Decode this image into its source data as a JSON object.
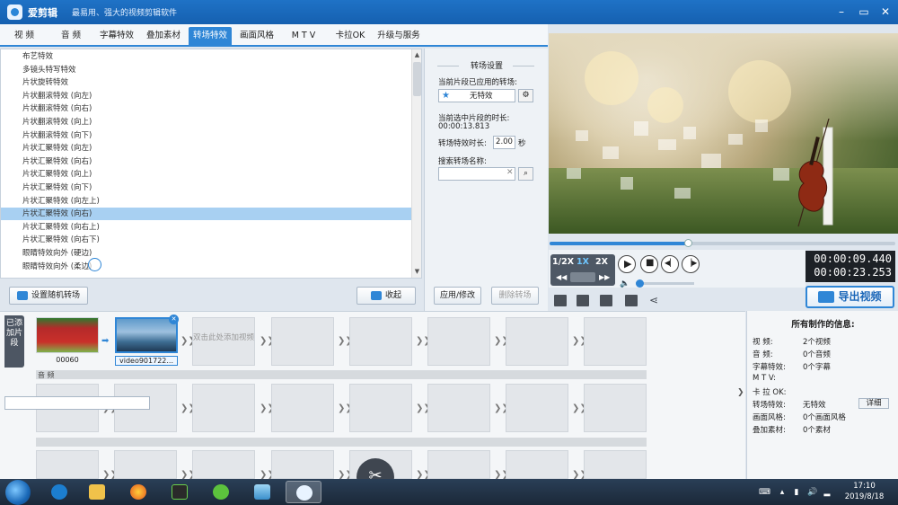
{
  "window": {
    "app_name": "爱剪辑",
    "slogan": "最易用、强大的视频剪辑软件",
    "controls": [
      "–",
      "▭",
      "✕"
    ]
  },
  "tabs": [
    "视 频",
    "音 频",
    "字幕特效",
    "叠加素材",
    "转场特效",
    "画面风格",
    "M T V",
    "卡拉OK",
    "升级与服务"
  ],
  "active_tab": "转场特效",
  "effects": {
    "items": [
      "布艺特效",
      "多镜头特写特效",
      "片状旋转特效",
      "片状翻滚特效 (向左)",
      "片状翻滚特效 (向右)",
      "片状翻滚特效 (向上)",
      "片状翻滚特效 (向下)",
      "片状汇聚特效 (向左)",
      "片状汇聚特效 (向右)",
      "片状汇聚特效 (向上)",
      "片状汇聚特效 (向下)",
      "片状汇聚特效 (向左上)",
      "片状汇聚特效 (向右)",
      "片状汇聚特效 (向右上)",
      "片状汇聚特效 (向右下)",
      "眼睛特效向外 (硬边)",
      "眼睛特效向外 (柔边)"
    ],
    "selected_index": 12,
    "random_button": "设置随机转场",
    "collapse_button": "收起"
  },
  "settings": {
    "title": "转场设置",
    "applied_label": "当前片段已应用的转场:",
    "applied_value": "无特效",
    "duration_label": "当前选中片段的时长:",
    "duration_value": "00:00:13.813",
    "effect_duration_label": "转场特效时长:",
    "effect_duration_value": "2.00",
    "effect_duration_unit": "秒",
    "search_label": "搜索转场名称:",
    "search_value": "",
    "apply_button": "应用/修改",
    "delete_button": "删除转场"
  },
  "player": {
    "speeds": [
      "1/2X",
      "1X",
      "2X"
    ],
    "active_speed": "1X",
    "progress": 0.4,
    "current_time": "00:00:09.440",
    "total_time": "00:00:23.253",
    "export_button": "导出视频"
  },
  "timeline": {
    "side_label": "已添加片段",
    "clips": [
      {
        "label": "00060"
      },
      {
        "label": "video901722..."
      }
    ],
    "empty_slot_text": "双击此处添加视频",
    "audio_label": "音 频"
  },
  "info": {
    "title": "所有制作的信息:",
    "rows": [
      {
        "key": "视    频:",
        "value": "2个视频"
      },
      {
        "key": "音    频:",
        "value": "0个音频"
      },
      {
        "key": "字幕特效:",
        "value": "0个字幕"
      },
      {
        "key": "M  T  V:",
        "value": ""
      },
      {
        "key": "卡 拉 OK:",
        "value": ""
      },
      {
        "key": "转场特效:",
        "value": "无特效"
      },
      {
        "key": "画面风格:",
        "value": "0个画面风格"
      },
      {
        "key": "叠加素材:",
        "value": "0个素材"
      }
    ],
    "detail_button": "详细"
  },
  "taskbar": {
    "time": "17:10",
    "date": "2019/8/18"
  },
  "colors": {
    "accent": "#2f86d6",
    "selection": "#a8d0f2",
    "titlebar": "#1f72c6"
  }
}
